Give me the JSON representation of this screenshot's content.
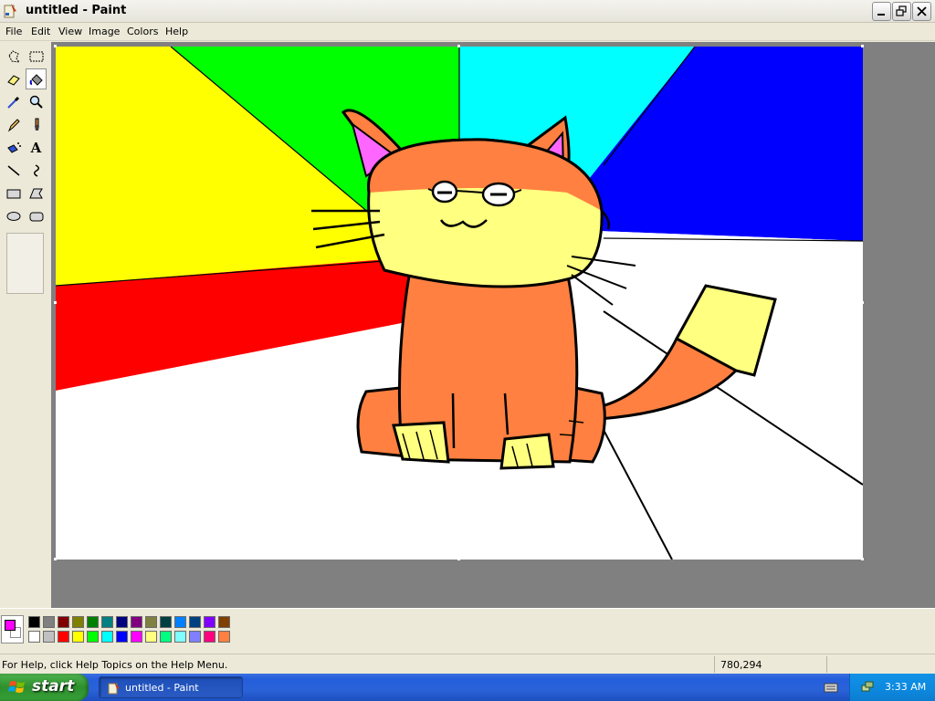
{
  "window": {
    "title": "untitled - Paint"
  },
  "menu": [
    "File",
    "Edit",
    "View",
    "Image",
    "Colors",
    "Help"
  ],
  "tools": [
    {
      "name": "free-form-select",
      "icon": "free-form-select-icon"
    },
    {
      "name": "rectangle-select",
      "icon": "rectangle-select-icon"
    },
    {
      "name": "eraser",
      "icon": "eraser-icon"
    },
    {
      "name": "fill-with-color",
      "icon": "fill-bucket-icon",
      "active": true
    },
    {
      "name": "pick-color",
      "icon": "eyedropper-icon"
    },
    {
      "name": "magnifier",
      "icon": "magnifier-icon"
    },
    {
      "name": "pencil",
      "icon": "pencil-icon"
    },
    {
      "name": "brush",
      "icon": "brush-icon"
    },
    {
      "name": "airbrush",
      "icon": "airbrush-icon"
    },
    {
      "name": "text",
      "icon": "text-icon",
      "glyph": "A"
    },
    {
      "name": "line",
      "icon": "line-icon"
    },
    {
      "name": "curve",
      "icon": "curve-icon"
    },
    {
      "name": "rectangle",
      "icon": "rectangle-icon"
    },
    {
      "name": "polygon",
      "icon": "polygon-icon"
    },
    {
      "name": "ellipse",
      "icon": "ellipse-icon"
    },
    {
      "name": "rounded-rectangle",
      "icon": "rounded-rectangle-icon"
    }
  ],
  "colors": {
    "foreground": "#ff00ff",
    "background": "#ffffff",
    "palette_top": [
      "#000000",
      "#808080",
      "#800000",
      "#808000",
      "#008000",
      "#008080",
      "#000080",
      "#800080",
      "#808040",
      "#004040",
      "#0080ff",
      "#004080",
      "#8000ff",
      "#804000"
    ],
    "palette_bottom": [
      "#ffffff",
      "#c0c0c0",
      "#ff0000",
      "#ffff00",
      "#00ff00",
      "#00ffff",
      "#0000ff",
      "#ff00ff",
      "#ffff80",
      "#00ff80",
      "#80ffff",
      "#8080ff",
      "#ff0080",
      "#ff8040"
    ]
  },
  "status": {
    "help_text": "For Help, click Help Topics on the Help Menu.",
    "coordinates": "780,294"
  },
  "taskbar": {
    "start_label": "start",
    "task_label": "untitled - Paint",
    "clock": "3:33 AM"
  }
}
